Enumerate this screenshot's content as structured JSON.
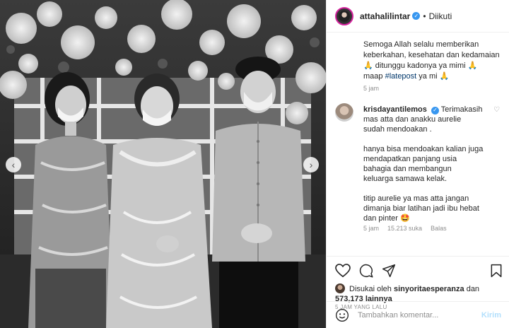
{
  "header": {
    "username": "attahalilintar",
    "separator": "•",
    "follow_status": "Diikuti"
  },
  "caption": {
    "lines": [
      "Semoga Allah selalu memberikan",
      "keberkahan, kesehatan dan kedamaian",
      "🙏 ditunggu kadonya ya mimi 🙏",
      "maap ",
      " ya mi 🙏"
    ],
    "hashtag": "#latepost",
    "time": "5 jam"
  },
  "comment": {
    "username": "krisdayantilemos",
    "first_line": " Terimakasih",
    "lines_a": [
      "mas atta dan anakku aurelie",
      "sudah mendoakan ."
    ],
    "lines_b": [
      "hanya bisa mendoakan kalian juga",
      "mendapatkan panjang usia",
      "bahagia dan membangun",
      "keluarga samawa kelak."
    ],
    "lines_c": [
      "titip aurelie ya mas atta jangan",
      "dimanja biar latihan jadi ibu hebat",
      "dan pinter 🤩"
    ],
    "time": "5 jam",
    "likes": "15.213 suka",
    "reply": "Balas"
  },
  "likes": {
    "prefix": "Disukai oleh ",
    "user": "sinyoritaesperanza",
    "middle": " dan",
    "count": "573,173",
    "suffix": " lainnya"
  },
  "posted": "5 JAM YANG LALU",
  "add_comment": {
    "placeholder": "Tambahkan komentar...",
    "post_label": "Kirim"
  },
  "nav": {
    "prev": "‹",
    "next": "›"
  },
  "colors": {
    "accent": "#3897f0",
    "link": "#00376b",
    "muted": "#8e8e8e",
    "disabled_blue": "#b2dffc"
  },
  "icons": [
    "heart-icon",
    "comment-icon",
    "share-icon",
    "bookmark-icon",
    "emoji-icon",
    "verified-badge-icon"
  ]
}
